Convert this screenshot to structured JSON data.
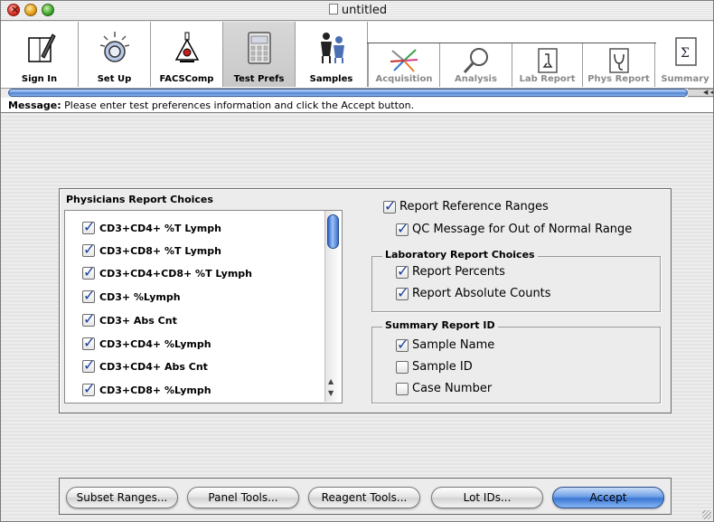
{
  "window": {
    "title": "untitled"
  },
  "toolbar": {
    "tools": [
      {
        "label": "Sign In",
        "icon": "sign-in-icon",
        "active": false,
        "disabled": false
      },
      {
        "label": "Set Up",
        "icon": "setup-icon",
        "active": false,
        "disabled": false
      },
      {
        "label": "FACSComp",
        "icon": "facscomp-icon",
        "active": false,
        "disabled": false
      },
      {
        "label": "Test Prefs",
        "icon": "test-prefs-icon",
        "active": true,
        "disabled": false
      },
      {
        "label": "Samples",
        "icon": "samples-icon",
        "active": false,
        "disabled": false
      },
      {
        "label": "Acquisition",
        "icon": "acquisition-icon",
        "active": false,
        "disabled": true
      },
      {
        "label": "Analysis",
        "icon": "analysis-icon",
        "active": false,
        "disabled": true
      },
      {
        "label": "Lab Report",
        "icon": "lab-report-icon",
        "active": false,
        "disabled": true
      },
      {
        "label": "Phys Report",
        "icon": "phys-report-icon",
        "active": false,
        "disabled": true
      },
      {
        "label": "Summary",
        "icon": "summary-icon",
        "active": false,
        "disabled": true
      }
    ]
  },
  "message": {
    "label": "Message:",
    "text": "Please enter test preferences information and click the Accept button."
  },
  "physicians": {
    "title": "Physicians Report Choices",
    "items": [
      {
        "label": "CD3+CD4+ %T Lymph",
        "checked": true
      },
      {
        "label": "CD3+CD8+ %T Lymph",
        "checked": true
      },
      {
        "label": "CD3+CD4+CD8+ %T Lymph",
        "checked": true
      },
      {
        "label": "CD3+ %Lymph",
        "checked": true
      },
      {
        "label": "CD3+ Abs Cnt",
        "checked": true
      },
      {
        "label": "CD3+CD4+ %Lymph",
        "checked": true
      },
      {
        "label": "CD3+CD4+ Abs Cnt",
        "checked": true
      },
      {
        "label": "CD3+CD8+ %Lymph",
        "checked": true
      }
    ]
  },
  "options": {
    "report_reference_ranges": {
      "label": "Report Reference Ranges",
      "checked": true
    },
    "qc_message": {
      "label": "QC Message for Out of Normal Range",
      "checked": true
    }
  },
  "laboratory": {
    "title": "Laboratory Report Choices",
    "report_percents": {
      "label": "Report Percents",
      "checked": true
    },
    "report_absolute": {
      "label": "Report Absolute Counts",
      "checked": true
    }
  },
  "summary": {
    "title": "Summary Report ID",
    "sample_name": {
      "label": "Sample Name",
      "checked": true
    },
    "sample_id": {
      "label": "Sample ID",
      "checked": false
    },
    "case_number": {
      "label": "Case Number",
      "checked": false
    }
  },
  "buttons": {
    "subset_ranges": "Subset Ranges...",
    "panel_tools": "Panel Tools...",
    "reagent_tools": "Reagent Tools...",
    "lot_ids": "Lot IDs...",
    "accept": "Accept"
  },
  "colors": {
    "accent": "#3c77d6",
    "check": "#1b3f9e"
  }
}
